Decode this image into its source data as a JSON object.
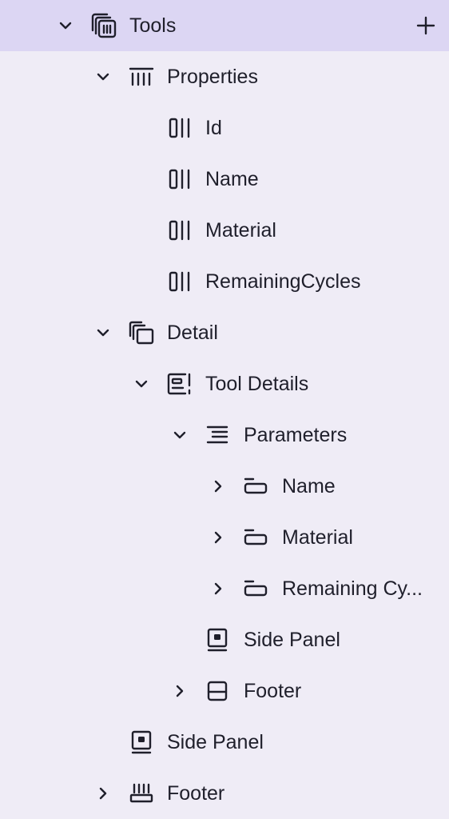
{
  "tree": {
    "tools": {
      "label": "Tools",
      "icon": "stack-icon",
      "expanded": true,
      "selected": true,
      "add_label": "+"
    },
    "properties": {
      "label": "Properties",
      "icon": "columns-icon",
      "expanded": true
    },
    "prop_id": {
      "label": "Id",
      "icon": "column-field-icon"
    },
    "prop_name": {
      "label": "Name",
      "icon": "column-field-icon"
    },
    "prop_material": {
      "label": "Material",
      "icon": "column-field-icon"
    },
    "prop_remaining": {
      "label": "RemainingCycles",
      "icon": "column-field-icon"
    },
    "detail": {
      "label": "Detail",
      "icon": "layers-icon",
      "expanded": true
    },
    "tool_details": {
      "label": "Tool Details",
      "icon": "detail-card-icon",
      "expanded": true
    },
    "parameters": {
      "label": "Parameters",
      "icon": "list-icon",
      "expanded": true
    },
    "param_name": {
      "label": "Name",
      "icon": "field-icon",
      "expanded": false
    },
    "param_material": {
      "label": "Material",
      "icon": "field-icon",
      "expanded": false
    },
    "param_remaining": {
      "label": "Remaining Cy...",
      "icon": "field-icon",
      "expanded": false
    },
    "side_panel_inner": {
      "label": "Side Panel",
      "icon": "side-panel-icon"
    },
    "footer_inner": {
      "label": "Footer",
      "icon": "footer-panel-icon",
      "expanded": false
    },
    "side_panel": {
      "label": "Side Panel",
      "icon": "side-panel-icon"
    },
    "footer": {
      "label": "Footer",
      "icon": "footer-bar-icon",
      "expanded": false
    }
  },
  "colors": {
    "background": "#efecf6",
    "selected": "#dcd6f3",
    "text": "#1f1f2b"
  }
}
